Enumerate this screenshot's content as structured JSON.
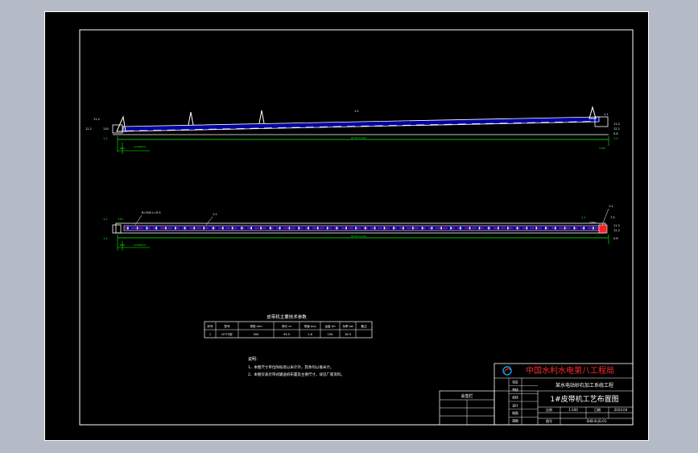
{
  "colors": {
    "background": "#000000",
    "frame": "#ffffff",
    "dimension": "#00ff00",
    "belt": "#0000a0",
    "rollers": "#ff2020",
    "title_red": "#ff2a2a"
  },
  "elevation_view": {
    "left_labels": [
      "11.2",
      "12.2",
      "110",
      "1.2",
      "880",
      "12000mm"
    ],
    "top_label": "1:1",
    "overall_dim": "93.5m*1.0m",
    "right_labels": [
      "1.1",
      "11.2",
      "12.2",
      "0.6",
      "1.0",
      "1760"
    ]
  },
  "plan_view": {
    "left_labels": [
      "1.2",
      "110",
      "880",
      "1.4",
      "12000mm"
    ],
    "callout_1": "B=500 L=9.5",
    "callout_2": "1:1",
    "overall_dim": "93.5m*1.0m",
    "right_labels": [
      "1.1",
      "1760",
      "7.5",
      "11.2",
      "12.2",
      "0.6"
    ],
    "callout_right": "1:1"
  },
  "spec_table": {
    "title": "皮带机主要技术参数",
    "headers": [
      "序号",
      "型号",
      "带宽 mm",
      "带长 m",
      "带速 m/s",
      "运量 t/h",
      "功率 kw",
      "备注"
    ],
    "row": [
      "1",
      "DT75型",
      "500",
      "93.5",
      "1.6",
      "150",
      "18.5",
      ""
    ]
  },
  "notes": {
    "title": "说明：",
    "items": [
      "1、本图尺寸单位除标高以米计外，其余均以毫米计。",
      "2、本图仅表示带式输送机布置及主要尺寸，详见厂家资料。"
    ]
  },
  "title_block": {
    "company": "中国水利水电第八工程局",
    "project": "某水电站砂石加工系统工程",
    "drawing_name": "1#皮带机工艺布置图",
    "approval_labels": [
      "审定",
      "审核",
      "校核",
      "设计",
      "制图",
      "描图"
    ],
    "approval_names": [
      "",
      "",
      "",
      "",
      "",
      ""
    ],
    "stamp_label": "会签栏",
    "scale_label": "比例",
    "scale_value": "1:100",
    "date_label": "日期",
    "date_value": "2010.04",
    "drawing_no_label": "图号",
    "drawing_no": "SHB-8-JG-01"
  }
}
